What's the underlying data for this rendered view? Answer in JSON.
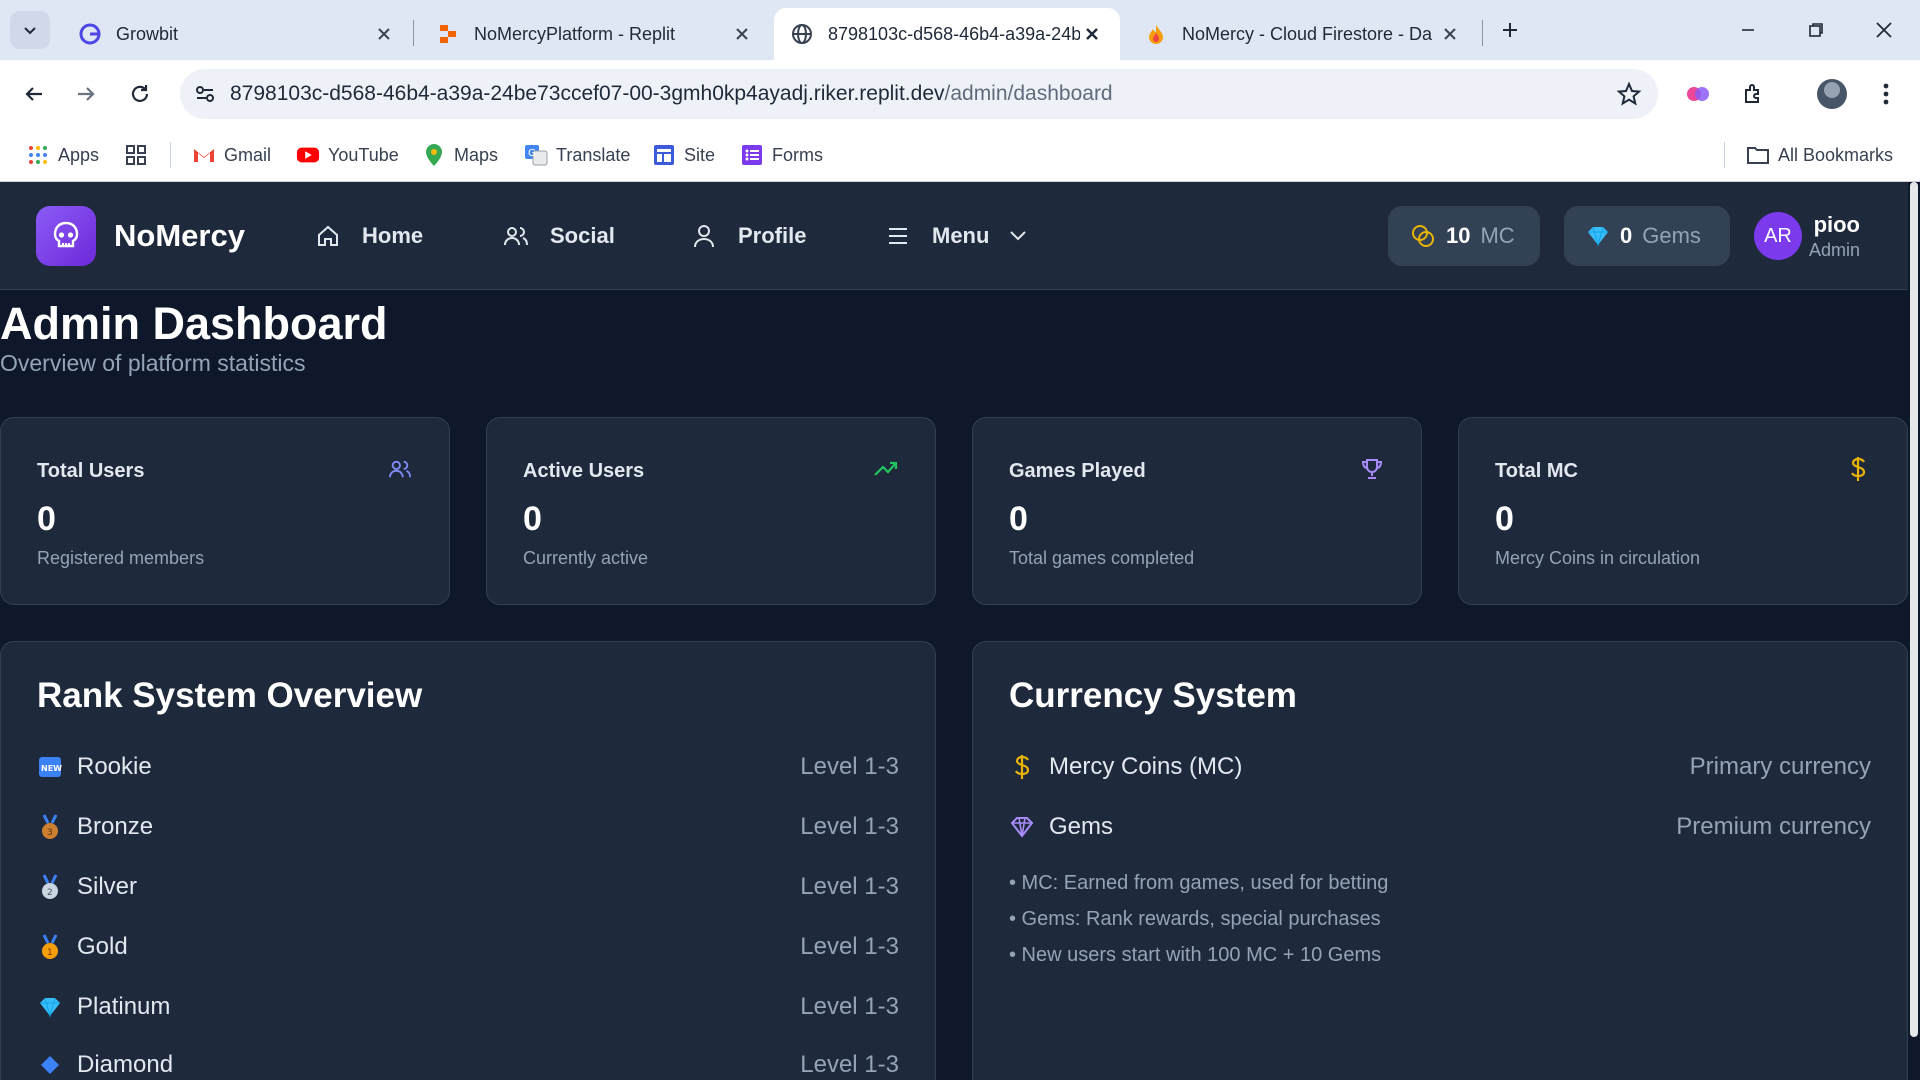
{
  "browser": {
    "tabs": [
      {
        "title": "Growbit",
        "active": false
      },
      {
        "title": "NoMercyPlatform - Replit",
        "active": false
      },
      {
        "title": "8798103c-d568-46b4-a39a-24b",
        "active": true
      },
      {
        "title": "NoMercy - Cloud Firestore - Da",
        "active": false
      }
    ],
    "url_host": "8798103c-d568-46b4-a39a-24be73ccef07-00-3gmh0kp4ayadj.riker.replit.dev",
    "url_path": "/admin/dashboard",
    "bookmarks": [
      "Apps",
      "Gmail",
      "YouTube",
      "Maps",
      "Translate",
      "Site",
      "Forms"
    ],
    "all_bookmarks": "All Bookmarks"
  },
  "app": {
    "brand": "NoMercy",
    "nav": {
      "home": "Home",
      "social": "Social",
      "profile": "Profile",
      "menu": "Menu"
    },
    "mc": {
      "value": "10",
      "unit": "MC"
    },
    "gems": {
      "value": "0",
      "unit": "Gems"
    },
    "user": {
      "initials": "AR",
      "name": "pioo",
      "role": "Admin"
    }
  },
  "page": {
    "title": "Admin Dashboard",
    "subtitle": "Overview of platform statistics"
  },
  "stats": [
    {
      "label": "Total Users",
      "value": "0",
      "desc": "Registered members",
      "icon": "users-icon"
    },
    {
      "label": "Active Users",
      "value": "0",
      "desc": "Currently active",
      "icon": "trending-up-icon"
    },
    {
      "label": "Games Played",
      "value": "0",
      "desc": "Total games completed",
      "icon": "trophy-icon"
    },
    {
      "label": "Total MC",
      "value": "0",
      "desc": "Mercy Coins in circulation",
      "icon": "dollar-icon"
    }
  ],
  "ranks": {
    "title": "Rank System Overview",
    "items": [
      {
        "name": "Rookie",
        "level": "Level 1-3"
      },
      {
        "name": "Bronze",
        "level": "Level 1-3"
      },
      {
        "name": "Silver",
        "level": "Level 1-3"
      },
      {
        "name": "Gold",
        "level": "Level 1-3"
      },
      {
        "name": "Platinum",
        "level": "Level 1-3"
      },
      {
        "name": "Diamond",
        "level": "Level 1-3"
      }
    ]
  },
  "currency": {
    "title": "Currency System",
    "items": [
      {
        "name": "Mercy Coins (MC)",
        "kind": "Primary currency"
      },
      {
        "name": "Gems",
        "kind": "Premium currency"
      }
    ],
    "notes": [
      "• MC: Earned from games, used for betting",
      "• Gems: Rank rewards, special purchases",
      "• New users start with 100 MC + 10 Gems"
    ]
  },
  "colors": {
    "bg": "#0f172a",
    "card": "#1e293b",
    "accent": "#8b5cf6",
    "green": "#22c55e",
    "gold": "#eab308"
  }
}
